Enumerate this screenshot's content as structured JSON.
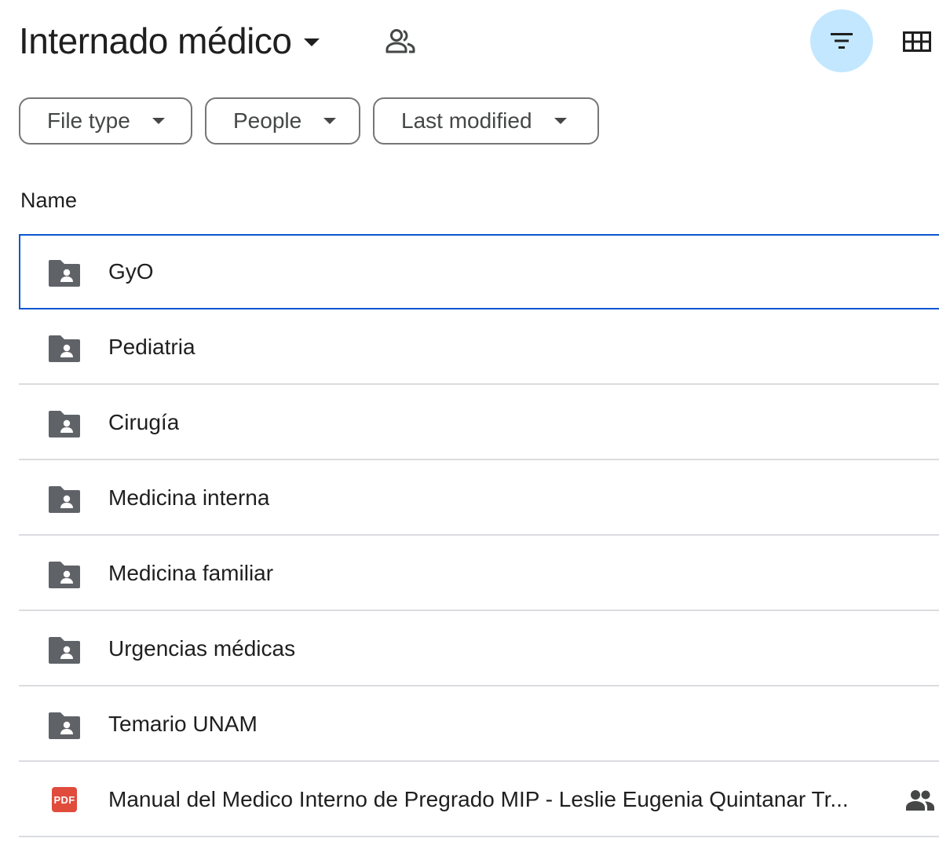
{
  "header": {
    "title": "Internado médico",
    "title_caret_icon": "caret-down-icon",
    "shared_icon": "people-outline-icon",
    "filter_icon": "filter-list-icon",
    "grid_icon": "grid-view-icon"
  },
  "filters": {
    "file_type": "File type",
    "people": "People",
    "last_modified": "Last modified"
  },
  "list": {
    "column_name": "Name",
    "items": [
      {
        "name": "GyO",
        "type": "shared-folder",
        "selected": true
      },
      {
        "name": "Pediatria",
        "type": "shared-folder"
      },
      {
        "name": "Cirugía",
        "type": "shared-folder"
      },
      {
        "name": "Medicina interna",
        "type": "shared-folder"
      },
      {
        "name": "Medicina familiar",
        "type": "shared-folder"
      },
      {
        "name": "Urgencias médicas",
        "type": "shared-folder"
      },
      {
        "name": "Temario UNAM",
        "type": "shared-folder"
      },
      {
        "name": "Manual del Medico Interno de Pregrado MIP - Leslie Eugenia Quintanar Tr...",
        "type": "pdf",
        "pdf_label": "PDF",
        "shared": true
      }
    ]
  },
  "colors": {
    "accent_bg": "#c2e7ff",
    "selection_border": "#0b57d0",
    "pdf_red": "#e04b3c",
    "icon_gray": "#5f6368"
  }
}
